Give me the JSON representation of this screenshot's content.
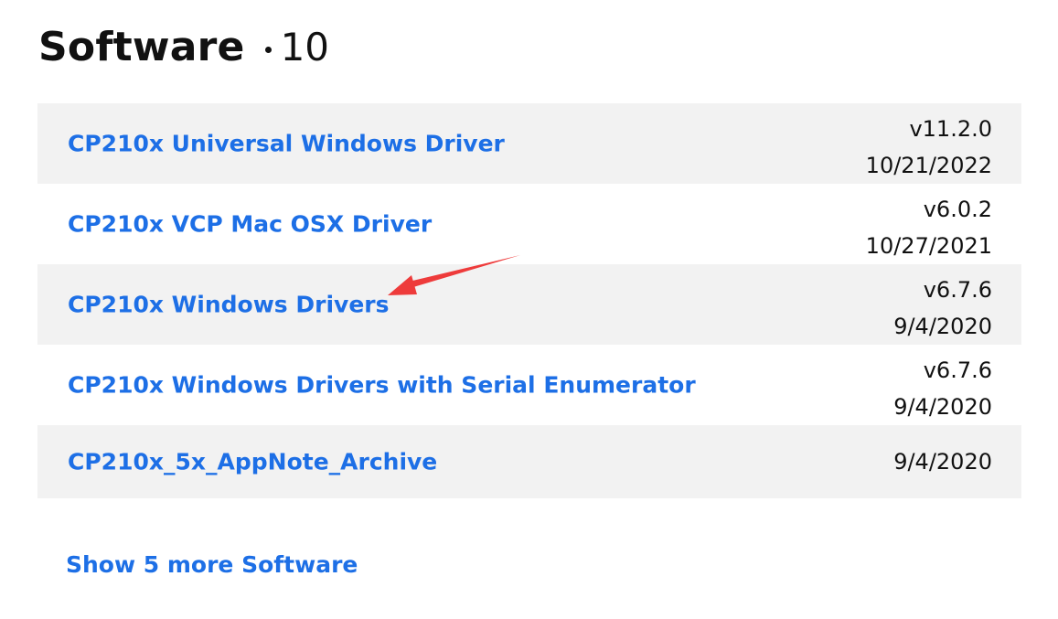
{
  "section": {
    "title": "Software",
    "count": "10"
  },
  "items": [
    {
      "name": "CP210x Universal Windows Driver",
      "version": "v11.2.0",
      "date": "10/21/2022"
    },
    {
      "name": "CP210x VCP Mac OSX Driver",
      "version": "v6.0.2",
      "date": "10/27/2021"
    },
    {
      "name": "CP210x Windows Drivers",
      "version": "v6.7.6",
      "date": "9/4/2020"
    },
    {
      "name": "CP210x Windows Drivers with Serial Enumerator",
      "version": "v6.7.6",
      "date": "9/4/2020"
    },
    {
      "name": "CP210x_5x_AppNote_Archive",
      "version": "",
      "date": "9/4/2020"
    }
  ],
  "show_more": "Show 5 more Software",
  "annotation": {
    "arrow_color": "#ee3b3b",
    "points_to": "CP210x Windows Drivers"
  },
  "colors": {
    "link": "#1d6fe6",
    "row_alt": "#f2f2f2",
    "text": "#111111"
  }
}
